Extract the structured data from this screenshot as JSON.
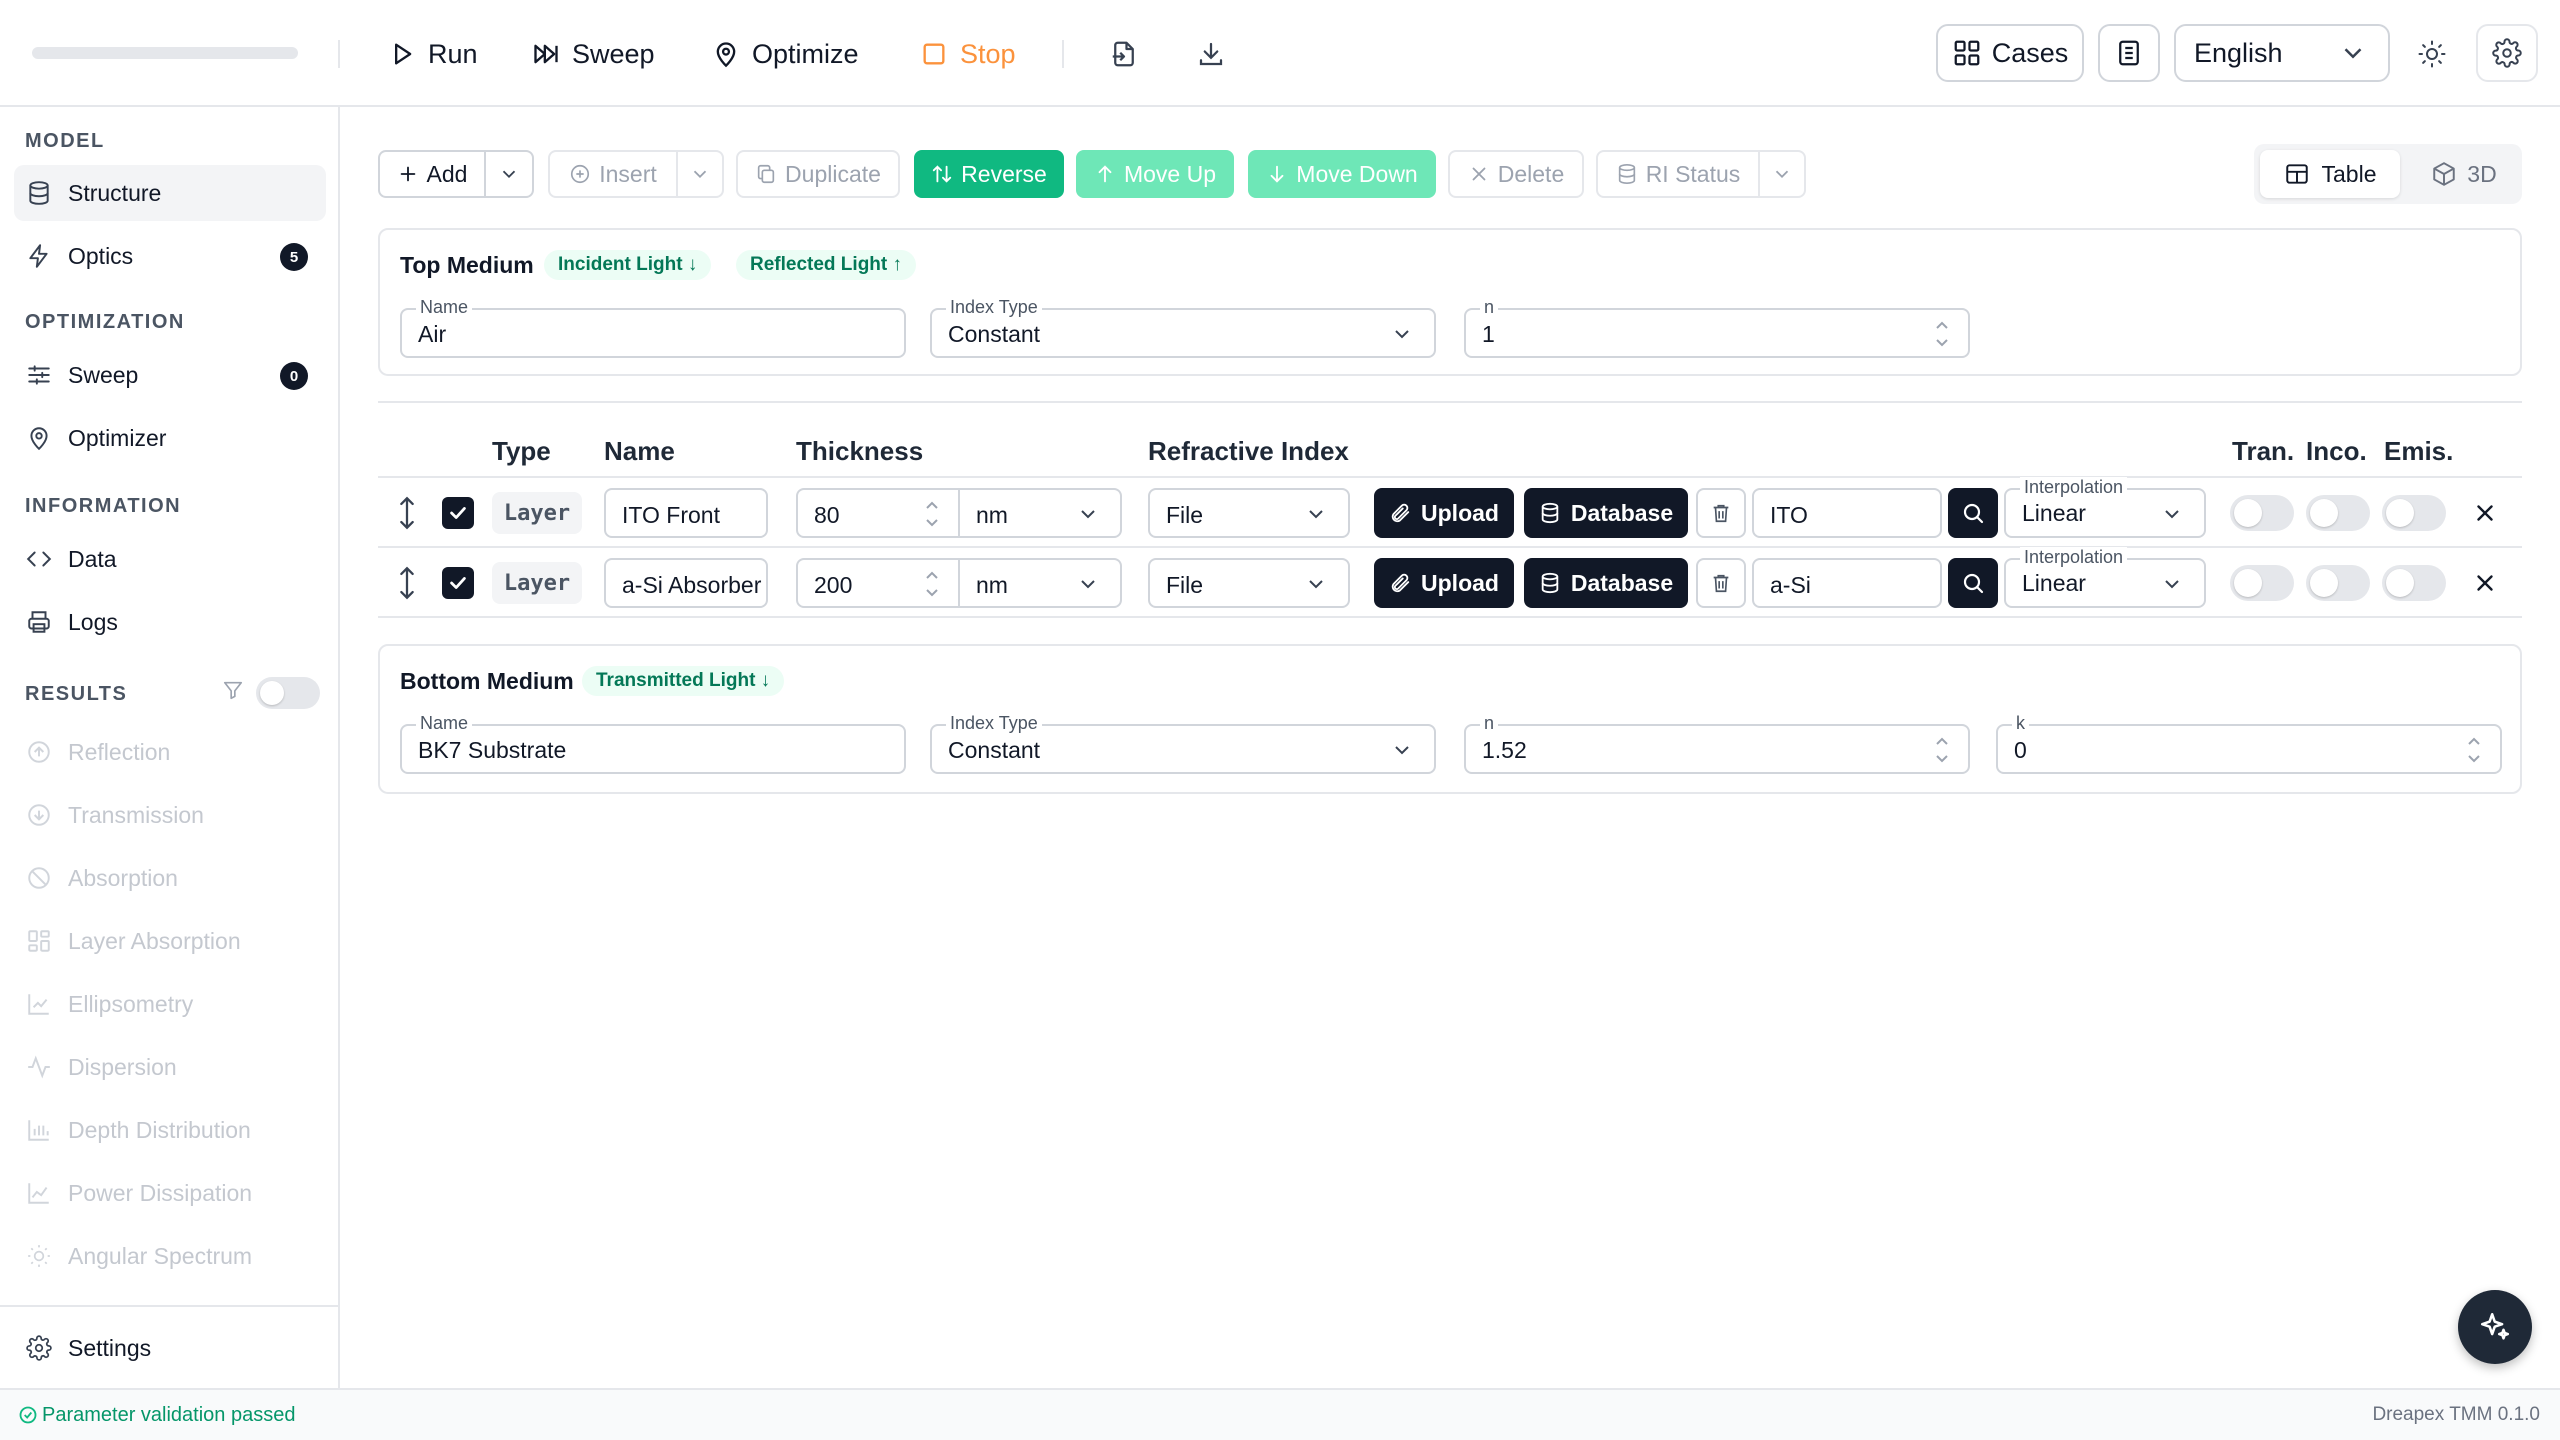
{
  "toolbar": {
    "run": "Run",
    "sweep": "Sweep",
    "optimize": "Optimize",
    "stop": "Stop",
    "cases": "Cases",
    "language": "English"
  },
  "sidebar": {
    "model_heading": "MODEL",
    "structure": "Structure",
    "optics": "Optics",
    "optics_badge": "5",
    "optimization_heading": "OPTIMIZATION",
    "sweep": "Sweep",
    "sweep_badge": "0",
    "optimizer": "Optimizer",
    "information_heading": "INFORMATION",
    "data": "Data",
    "logs": "Logs",
    "results_heading": "RESULTS",
    "results": [
      "Reflection",
      "Transmission",
      "Absorption",
      "Layer Absorption",
      "Ellipsometry",
      "Dispersion",
      "Depth Distribution",
      "Power Dissipation",
      "Angular Spectrum"
    ],
    "settings": "Settings"
  },
  "actions": {
    "add": "Add",
    "insert": "Insert",
    "duplicate": "Duplicate",
    "reverse": "Reverse",
    "move_up": "Move Up",
    "move_down": "Move Down",
    "delete": "Delete",
    "ri_status": "RI Status",
    "view_table": "Table",
    "view_3d": "3D"
  },
  "top_medium": {
    "title": "Top Medium",
    "incident": "Incident Light ↓",
    "reflected": "Reflected Light ↑",
    "name_label": "Name",
    "name": "Air",
    "index_type_label": "Index Type",
    "index_type": "Constant",
    "n_label": "n",
    "n": "1"
  },
  "table": {
    "headers": {
      "type": "Type",
      "name": "Name",
      "thickness": "Thickness",
      "refractive_index": "Refractive Index",
      "tran": "Tran.",
      "inco": "Inco.",
      "emis": "Emis."
    },
    "upload": "Upload",
    "database": "Database",
    "interp_label": "Interpolation",
    "rows": [
      {
        "type": "Layer",
        "name": "ITO Front",
        "thickness": "80",
        "unit": "nm",
        "source": "File",
        "material": "ITO",
        "interp": "Linear"
      },
      {
        "type": "Layer",
        "name": "a-Si Absorber",
        "thickness": "200",
        "unit": "nm",
        "source": "File",
        "material": "a-Si",
        "interp": "Linear"
      }
    ]
  },
  "bottom_medium": {
    "title": "Bottom Medium",
    "transmitted": "Transmitted Light ↓",
    "name_label": "Name",
    "name": "BK7 Substrate",
    "index_type_label": "Index Type",
    "index_type": "Constant",
    "n_label": "n",
    "n": "1.52",
    "k_label": "k",
    "k": "0"
  },
  "status": {
    "message": "Parameter validation passed",
    "version": "Dreapex TMM 0.1.0"
  }
}
